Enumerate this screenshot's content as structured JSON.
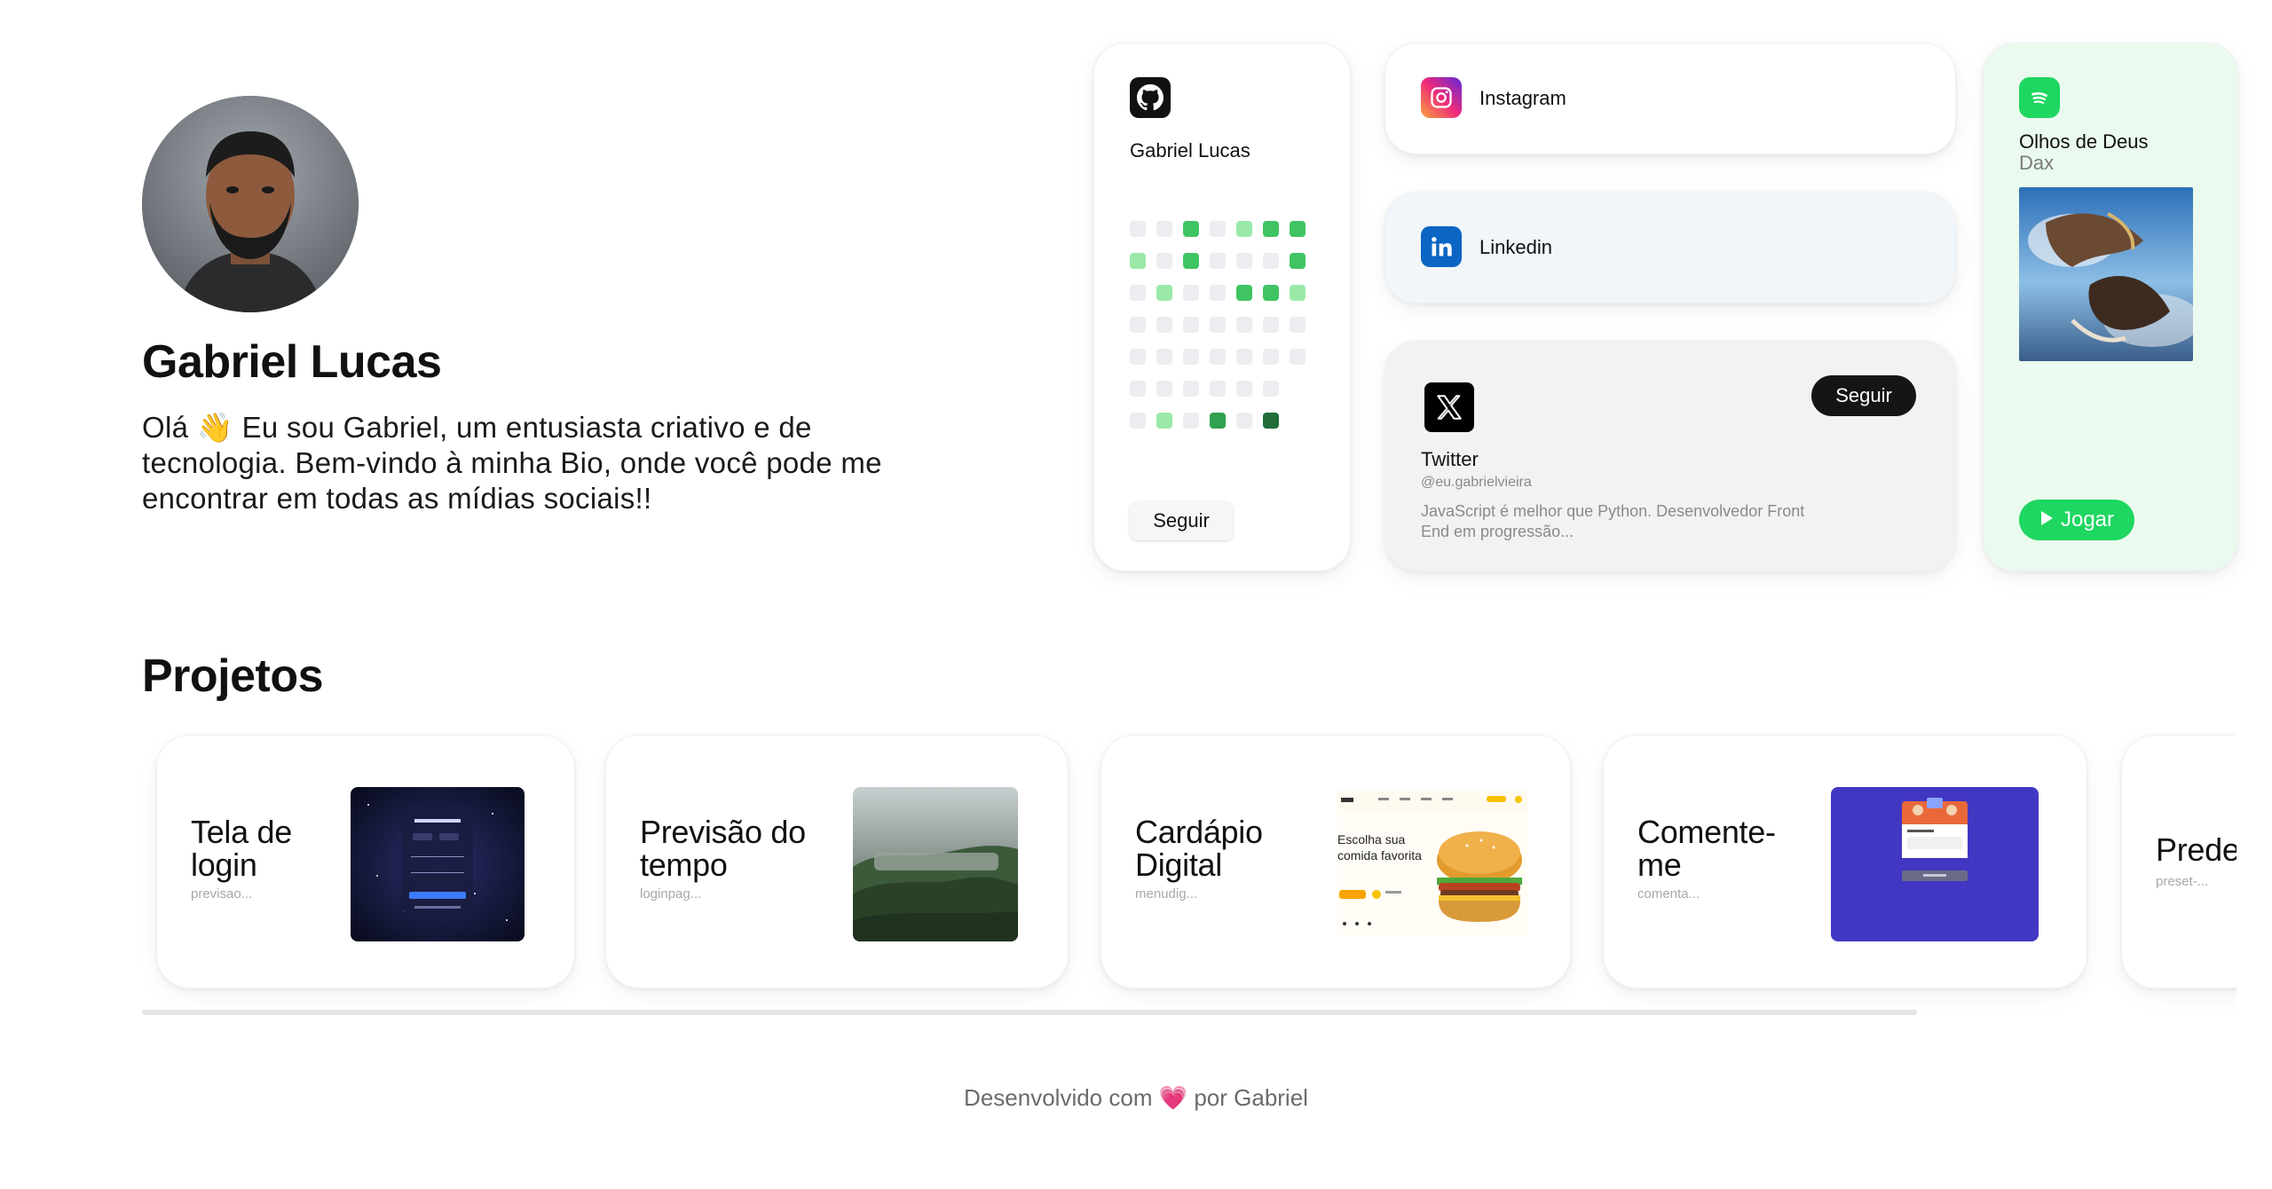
{
  "profile": {
    "name": "Gabriel Lucas",
    "bio": "Olá 👋 Eu sou Gabriel, um entusiasta criativo e de tecnologia. Bem-vindo à minha Bio, onde você pode me encontrar em todas as mídias sociais!!"
  },
  "github": {
    "icon": "github-icon",
    "name": "Gabriel Lucas",
    "follow_label": "Seguir",
    "contributions": [
      [
        0,
        0,
        2,
        0,
        1,
        2,
        2
      ],
      [
        1,
        0,
        2,
        0,
        0,
        0,
        2
      ],
      [
        0,
        1,
        0,
        0,
        2,
        2,
        1
      ],
      [
        0,
        0,
        0,
        0,
        0,
        0,
        0
      ],
      [
        0,
        0,
        0,
        0,
        0,
        0,
        0
      ],
      [
        0,
        0,
        0,
        0,
        0,
        0,
        -1
      ],
      [
        0,
        1,
        0,
        3,
        0,
        4,
        -1
      ]
    ]
  },
  "instagram": {
    "icon": "instagram-icon",
    "label": "Instagram"
  },
  "linkedin": {
    "icon": "linkedin-icon",
    "label": "Linkedin"
  },
  "twitter": {
    "icon": "x-icon",
    "name": "Twitter",
    "handle": "@eu.gabrielvieira",
    "description": "JavaScript é melhor que Python. Desenvolvedor Front End em progressão...",
    "follow_label": "Seguir"
  },
  "spotify": {
    "icon": "spotify-icon",
    "song": "Olhos de Deus",
    "artist": "Dax",
    "play_label": "Jogar"
  },
  "projects": {
    "title": "Projetos",
    "items": [
      {
        "title": "Tela de login",
        "subtitle": "previsao..."
      },
      {
        "title": "Previsão do tempo",
        "subtitle": "loginpag..."
      },
      {
        "title": "Cardápio Digital",
        "subtitle": "menudig..."
      },
      {
        "title": "Comente-me",
        "subtitle": "comenta..."
      },
      {
        "title": "Predef",
        "subtitle": "preset-..."
      }
    ],
    "thumb_texts": {
      "burger_headline_1": "Escolha sua",
      "burger_headline_2": "comida favorita"
    }
  },
  "footer": {
    "prefix": "Desenvolvido com",
    "heart": "💗",
    "suffix": "por Gabriel"
  },
  "colors": {
    "accent_green": "#1ed760",
    "github_level_1": "#9be9a8",
    "github_level_2": "#40c463",
    "github_level_3": "#30a14e",
    "github_level_4": "#216e39",
    "linkedin_blue": "#0a66c2"
  }
}
